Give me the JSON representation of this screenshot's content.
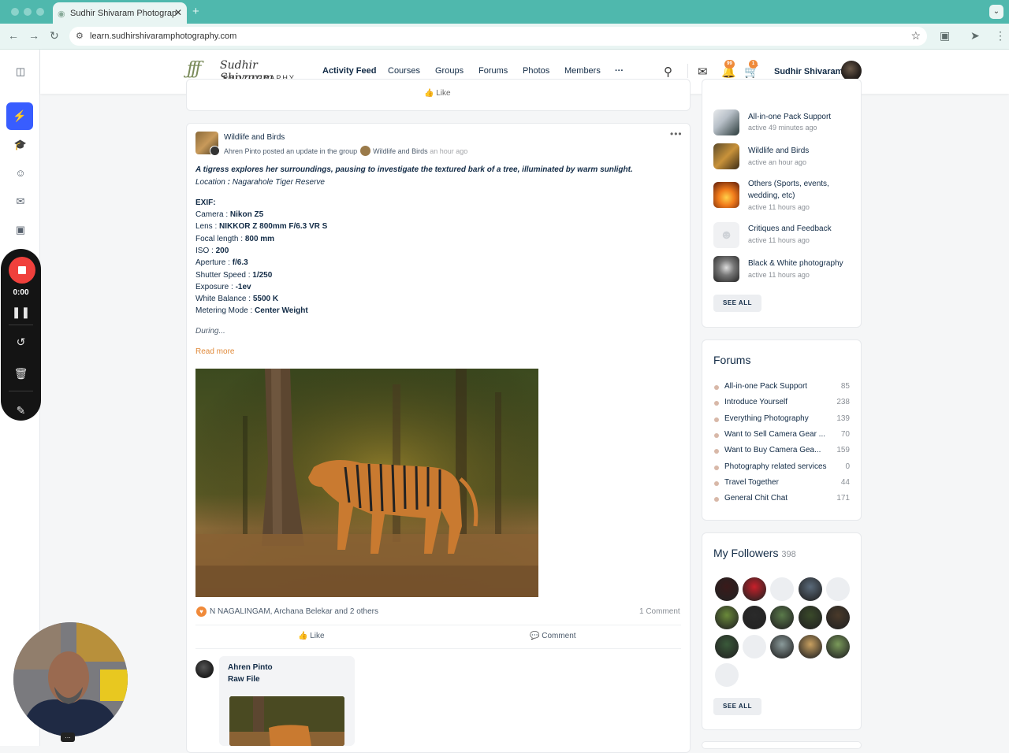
{
  "browser": {
    "tab_title": "Sudhir Shivaram Photograp",
    "tab_icon": "site-logo-icon",
    "url": "learn.sudhirshivaramphotography.com"
  },
  "recorder": {
    "time": "0:00"
  },
  "header": {
    "logo_script": "Sudhir Shivaram",
    "logo_sub": "PHOTOGRAPHY",
    "menu": [
      "Activity Feed",
      "Courses",
      "Groups",
      "Forums",
      "Photos",
      "Members"
    ],
    "more": "···",
    "notifications_count": "99",
    "cart_count": "1",
    "user_name": "Sudhir Shivaram"
  },
  "prev_post": {
    "like_label": "Like"
  },
  "post": {
    "group_name": "Wildlife and Birds",
    "author": "Ahren Pinto",
    "action_text": "posted an update in the group",
    "group_link": "Wildlife and Birds",
    "time": "an hour ago",
    "headline": "A tigress explores her surroundings, pausing to investigate the textured bark of a tree, illuminated by warm sunlight.",
    "location_label": "Location",
    "location_value": "Nagarahole Tiger Reserve",
    "exif_title": "EXIF:",
    "exif": [
      {
        "label": "Camera",
        "sep": " : ",
        "value": "Nikon Z5"
      },
      {
        "label": "Lens",
        "sep": " : ",
        "value": "NIKKOR Z 800mm F/6.3 VR S"
      },
      {
        "label": "Focal length",
        "sep": " : ",
        "value": "800 mm"
      },
      {
        "label": "ISO",
        "sep": " : ",
        "value": "200"
      },
      {
        "label": "Aperture",
        "sep": " : ",
        "value": "f/6.3"
      },
      {
        "label": "Shutter Speed",
        "sep": " : ",
        "value": "1/250"
      },
      {
        "label": "Exposure",
        "sep": " : ",
        "value": "-1ev"
      },
      {
        "label": "White Balance",
        "sep": " : ",
        "value": "5500 K"
      },
      {
        "label": "Metering Mode",
        "sep": " : ",
        "value": "Center Weight"
      }
    ],
    "truncated": "During...",
    "read_more": "Read more",
    "reactors": "N NAGALINGAM, Archana Belekar and 2 others",
    "comment_count": "1 Comment",
    "like_label": "Like",
    "comment_label": "Comment"
  },
  "comment": {
    "author": "Ahren Pinto",
    "text": "Raw File"
  },
  "groups": {
    "items": [
      {
        "name": "All-in-one Pack Support",
        "active": "active 49 minutes ago"
      },
      {
        "name": "Wildlife and Birds",
        "active": "active an hour ago"
      },
      {
        "name": "Others (Sports, events, wedding, etc)",
        "active": "active 11 hours ago"
      },
      {
        "name": "Critiques and Feedback",
        "active": "active 11 hours ago"
      },
      {
        "name": "Black & White photography",
        "active": "active 11 hours ago"
      }
    ],
    "see_all": "SEE ALL"
  },
  "forums": {
    "title": "Forums",
    "items": [
      {
        "name": "All-in-one Pack Support",
        "count": "85"
      },
      {
        "name": "Introduce Yourself",
        "count": "238"
      },
      {
        "name": "Everything Photography",
        "count": "139"
      },
      {
        "name": "Want to Sell Camera Gear ...",
        "count": "70"
      },
      {
        "name": "Want to Buy Camera Gea...",
        "count": "159"
      },
      {
        "name": "Photography related services",
        "count": "0"
      },
      {
        "name": "Travel Together",
        "count": "44"
      },
      {
        "name": "General Chit Chat",
        "count": "171"
      }
    ]
  },
  "followers": {
    "title": "My Followers",
    "count": "398",
    "see_all": "SEE ALL"
  },
  "colors": {
    "accent": "#385dff",
    "tab_bar": "#4fb8ad",
    "read_more": "#e08a3a",
    "record": "#f0403c"
  }
}
